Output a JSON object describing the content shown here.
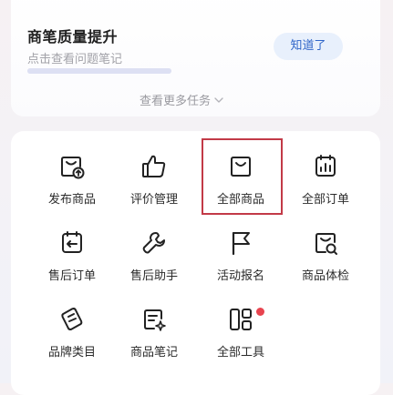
{
  "task_card": {
    "title": "商笔质量提升",
    "subtitle": "点击查看问题笔记",
    "ack_button": "知道了",
    "more_tasks": "查看更多任务"
  },
  "tools": [
    {
      "label": "发布商品",
      "icon": "publish-product-icon"
    },
    {
      "label": "评价管理",
      "icon": "thumbs-up-icon"
    },
    {
      "label": "全部商品",
      "icon": "shopping-bag-icon",
      "highlighted": true
    },
    {
      "label": "全部订单",
      "icon": "order-chart-icon"
    },
    {
      "label": "售后订单",
      "icon": "after-sale-order-icon"
    },
    {
      "label": "售后助手",
      "icon": "wrench-icon"
    },
    {
      "label": "活动报名",
      "icon": "flag-icon"
    },
    {
      "label": "商品体检",
      "icon": "product-inspection-icon"
    },
    {
      "label": "品牌类目",
      "icon": "brand-category-icon"
    },
    {
      "label": "商品笔记",
      "icon": "product-note-icon"
    },
    {
      "label": "全部工具",
      "icon": "all-tools-icon",
      "has_badge": true
    }
  ],
  "colors": {
    "accent": "#2f65c8",
    "highlight_border": "#c23a47",
    "badge": "#e8444f"
  }
}
